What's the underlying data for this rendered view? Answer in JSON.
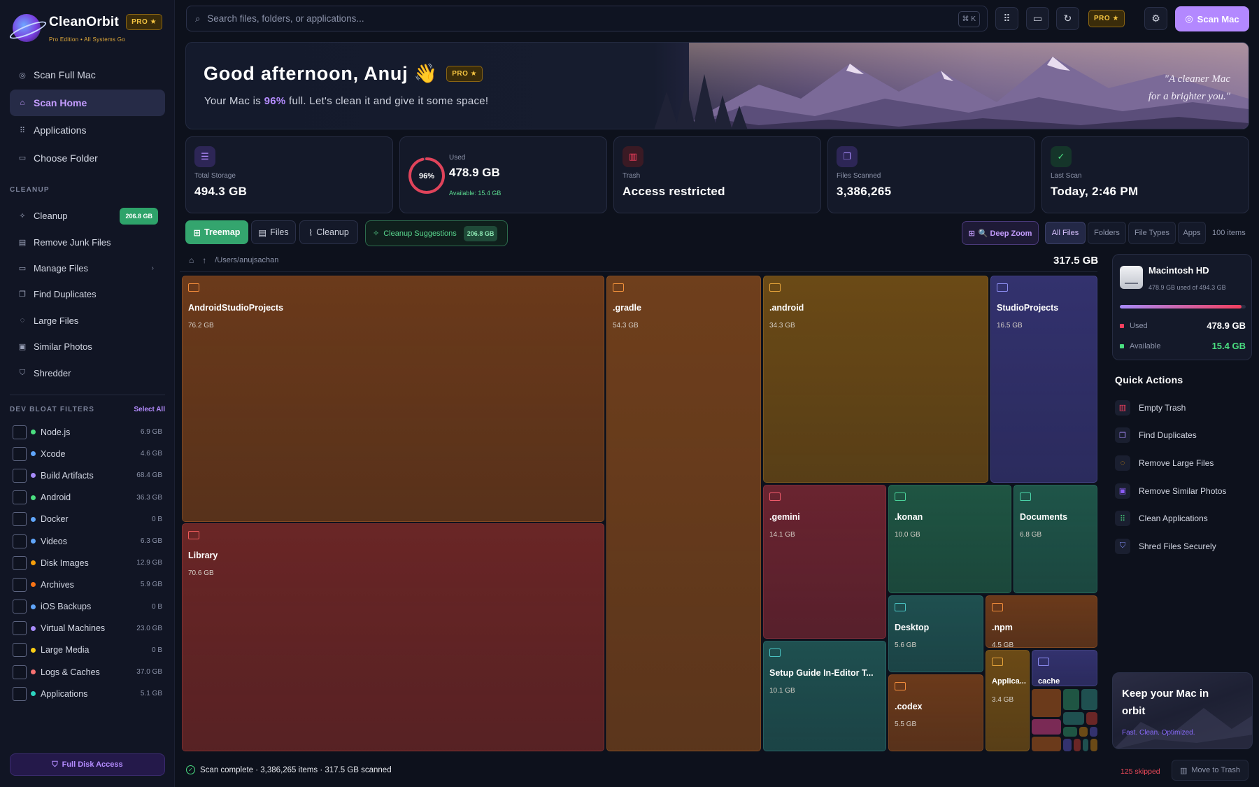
{
  "app": {
    "name": "CleanOrbit",
    "pro_label": "PRO ★",
    "subtitle": "Pro Edition • All Systems Go"
  },
  "nav": [
    {
      "label": "Scan Full Mac",
      "icon": "target-icon"
    },
    {
      "label": "Scan Home",
      "icon": "home-icon",
      "active": true
    },
    {
      "label": "Applications",
      "icon": "grid-icon"
    },
    {
      "label": "Choose Folder",
      "icon": "folder-icon"
    }
  ],
  "cleanup": {
    "section_label": "CLEANUP",
    "items": [
      {
        "label": "Cleanup",
        "badge": "206.8 GB"
      },
      {
        "label": "Remove Junk Files"
      },
      {
        "label": "Manage Files"
      },
      {
        "label": "Find Duplicates"
      },
      {
        "label": "Large Files"
      },
      {
        "label": "Similar Photos"
      },
      {
        "label": "Shredder"
      }
    ]
  },
  "dev_bloat": {
    "section_label": "DEV BLOAT FILTERS",
    "select_all": "Select All",
    "items": [
      {
        "label": "Node.js",
        "size": "6.9 GB",
        "color": "#4ade80"
      },
      {
        "label": "Xcode",
        "size": "4.6 GB",
        "color": "#60a5fa"
      },
      {
        "label": "Build Artifacts",
        "size": "68.4 GB",
        "color": "#a78bfa"
      },
      {
        "label": "Android",
        "size": "36.3 GB",
        "color": "#4ade80"
      },
      {
        "label": "Docker",
        "size": "0 B",
        "color": "#60a5fa"
      },
      {
        "label": "Videos",
        "size": "6.3 GB",
        "color": "#60a5fa"
      },
      {
        "label": "Disk Images",
        "size": "12.9 GB",
        "color": "#f59e0b"
      },
      {
        "label": "Archives",
        "size": "5.9 GB",
        "color": "#f97316"
      },
      {
        "label": "iOS Backups",
        "size": "0 B",
        "color": "#60a5fa"
      },
      {
        "label": "Virtual Machines",
        "size": "23.0 GB",
        "color": "#a78bfa"
      },
      {
        "label": "Large Media",
        "size": "0 B",
        "color": "#facc15"
      },
      {
        "label": "Logs & Caches",
        "size": "37.0 GB",
        "color": "#f87171"
      },
      {
        "label": "Applications",
        "size": "5.1 GB",
        "color": "#2dd4bf"
      }
    ]
  },
  "full_disk_access": "Full Disk Access",
  "search": {
    "placeholder": "Search files, folders, or applications...",
    "shortcut": "⌘ K"
  },
  "toolbar": {
    "pro_label": "PRO ★",
    "scan_mac": "Scan Mac"
  },
  "hero": {
    "greeting": "Good afternoon, Anuj 👋",
    "pro_label": "PRO ★",
    "sub_before": "Your Mac is ",
    "sub_pct": "96%",
    "sub_after": " full. Let's clean it and give it some space!",
    "quote_line1": "\"A cleaner Mac",
    "quote_line2": "for a brighter you.\""
  },
  "stats": {
    "total_label": "Total Storage",
    "total_value": "494.3 GB",
    "used_pct_label": "96%",
    "used_fraction": 0.96,
    "used_label": "Used",
    "used_value": "478.9 GB",
    "available": "Available: 15.4 GB",
    "trash_label": "Trash",
    "trash_value": "Access restricted",
    "scanned_label": "Files Scanned",
    "scanned_value": "3,386,265",
    "last_label": "Last Scan",
    "last_value": "Today, 2:46 PM"
  },
  "views": {
    "treemap": "Treemap",
    "files": "Files",
    "cleanup": "Cleanup",
    "suggestions": "Cleanup Suggestions",
    "suggestions_badge": "206.8 GB",
    "deep_zoom": "🔍 Deep Zoom",
    "filters": [
      "All Files",
      "Folders",
      "File Types",
      "Apps"
    ],
    "items_count": "100 items"
  },
  "breadcrumb": {
    "path": "/Users/anujsachan",
    "total": "317.5 GB"
  },
  "treemap": [
    {
      "name": "AndroidStudioProjects",
      "size": "76.2 GB",
      "bg": "#6b3a1b",
      "fg": "#f28c3b"
    },
    {
      "name": ".gradle",
      "size": "54.3 GB",
      "bg": "#6f3f1c",
      "fg": "#f2923b"
    },
    {
      "name": ".android",
      "size": "34.3 GB",
      "bg": "#6b4a16",
      "fg": "#e6a43b"
    },
    {
      "name": "StudioProjects",
      "size": "16.5 GB",
      "bg": "#33326e",
      "fg": "#8d8df2"
    },
    {
      "name": "Library",
      "size": "70.6 GB",
      "bg": "#6a2626",
      "fg": "#ef5b5b"
    },
    {
      "name": ".gemini",
      "size": "14.1 GB",
      "bg": "#6a2430",
      "fg": "#ef5b6b"
    },
    {
      "name": ".konan",
      "size": "10.0 GB",
      "bg": "#1f5543",
      "fg": "#4ad39a"
    },
    {
      "name": "Documents",
      "size": "6.8 GB",
      "bg": "#1f5549",
      "fg": "#4ad3a8"
    },
    {
      "name": "Desktop",
      "size": "5.6 GB",
      "bg": "#1f5050",
      "fg": "#4ac3c3"
    },
    {
      "name": ".npm",
      "size": "4.5 GB",
      "bg": "#6b3a1b",
      "fg": "#f28c3b"
    },
    {
      "name": "Setup Guide In-Editor T...",
      "size": "10.1 GB",
      "bg": "#1f5050",
      "fg": "#4ac3c3"
    },
    {
      "name": ".codex",
      "size": "5.5 GB",
      "bg": "#6b3a1b",
      "fg": "#f28c3b"
    },
    {
      "name": "Applica...",
      "size": "3.4 GB",
      "bg": "#6b4a16",
      "fg": "#e6a43b"
    },
    {
      "name": "cache",
      "size": "",
      "bg": "#33326e",
      "fg": "#8d8df2"
    }
  ],
  "disk": {
    "name": "Macintosh HD",
    "sub": "478.9 GB used of 494.3 GB",
    "used_fraction": 0.969,
    "used_label": "Used",
    "used_value": "478.9 GB",
    "avail_label": "Available",
    "avail_value": "15.4 GB",
    "used_color": "#f43f5e",
    "avail_color": "#4ade80"
  },
  "quick_actions": {
    "title": "Quick Actions",
    "items": [
      {
        "label": "Empty Trash",
        "color": "#f43f5e"
      },
      {
        "label": "Find Duplicates",
        "color": "#a78bfa"
      },
      {
        "label": "Remove Large Files",
        "color": "#f59e0b"
      },
      {
        "label": "Remove Similar Photos",
        "color": "#8b5cf6"
      },
      {
        "label": "Clean Applications",
        "color": "#4ade80"
      },
      {
        "label": "Shred Files Securely",
        "color": "#818cf8"
      }
    ]
  },
  "orbit_card": {
    "title": "Keep your Mac in orbit",
    "sub": "Fast. Clean. Optimized."
  },
  "status": {
    "text": "Scan complete · 3,386,265 items · 317.5 GB scanned",
    "skipped": "125 skipped",
    "move_to_trash": "Move to Trash"
  }
}
